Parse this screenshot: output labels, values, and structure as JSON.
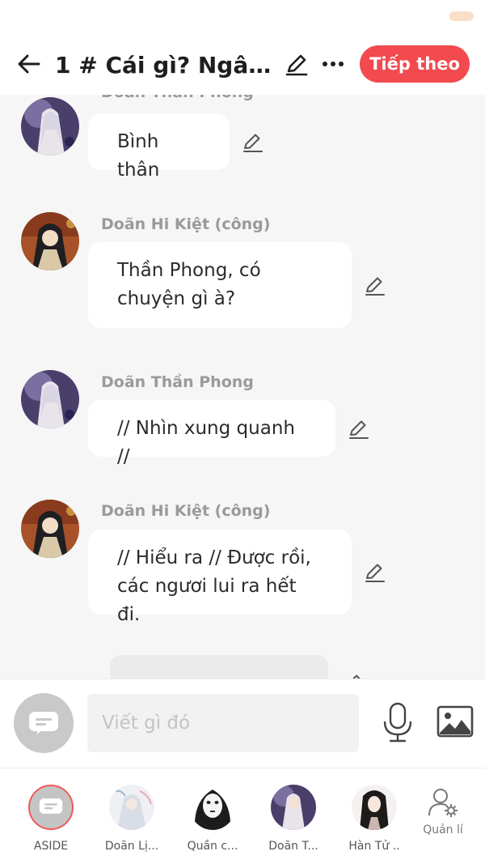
{
  "header": {
    "title": "1 # Cái gì? Ngâ...",
    "next_label": "Tiếp theo"
  },
  "messages": [
    {
      "sender": "Doãn Thần Phong",
      "lines": [
        "Bình thân"
      ]
    },
    {
      "sender": "Doãn Hi Kiệt (công)",
      "lines": [
        "Thần Phong, có",
        "chuyện gì à?"
      ]
    },
    {
      "sender": "Doãn Thần Phong",
      "lines": [
        "// Nhìn xung quanh //"
      ]
    },
    {
      "sender": "Doãn Hi Kiệt (công)",
      "lines": [
        "// Hiểu ra // Được rồi,",
        "các ngươi lui ra hết đi."
      ]
    }
  ],
  "composer": {
    "placeholder": "Viết gì đó"
  },
  "roles": [
    {
      "label": "ASIDE"
    },
    {
      "label": "Doãn Lị..."
    },
    {
      "label": "Quần c..."
    },
    {
      "label": "Doãn T..."
    },
    {
      "label": "Hàn Tử .."
    },
    {
      "label": "Quản lí"
    }
  ],
  "colors": {
    "accent": "#f24a4f",
    "background": "#f6f6f6",
    "bubble": "#ffffff"
  }
}
